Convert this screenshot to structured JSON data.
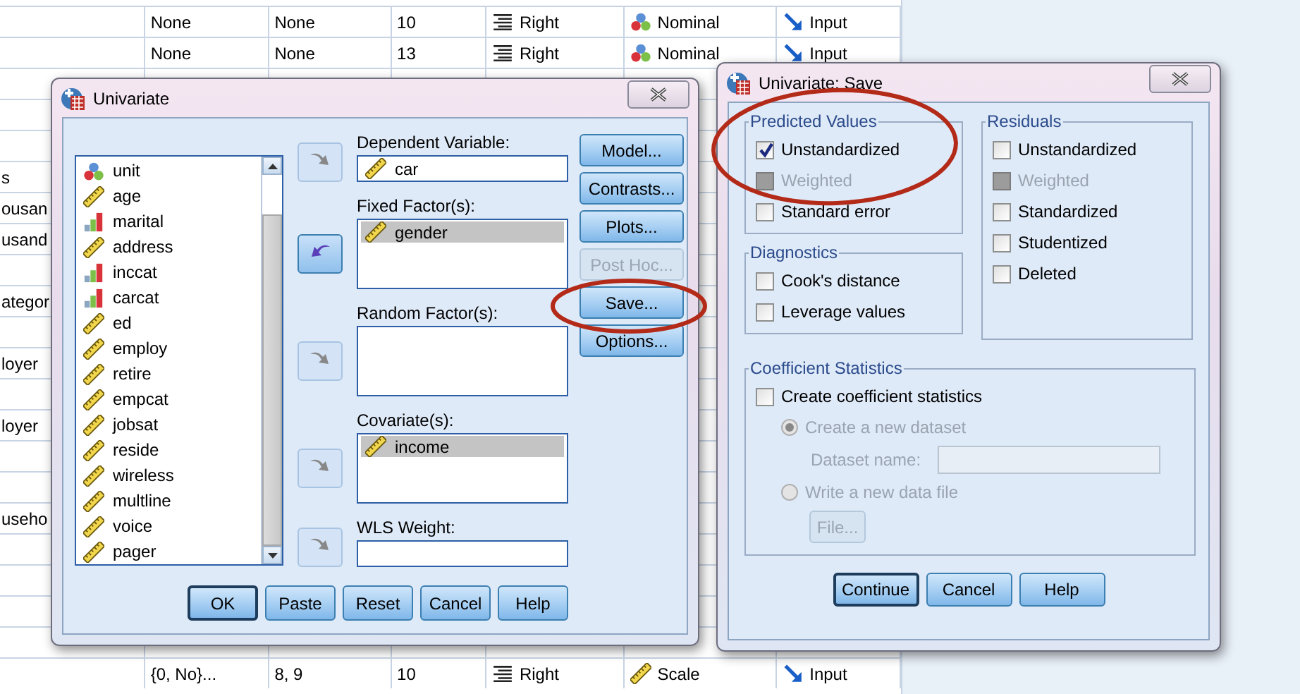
{
  "grid": {
    "rows": [
      {
        "kind": "nominal",
        "cells": [
          "None",
          "None",
          "10",
          "Right",
          "Nominal",
          "Input"
        ]
      },
      {
        "kind": "nominal",
        "cells": [
          "None",
          "None",
          "13",
          "Right",
          "Nominal",
          "Input"
        ]
      },
      {},
      {},
      {},
      {
        "label": "s"
      },
      {
        "label": "ousan"
      },
      {
        "label": "usand"
      },
      {},
      {
        "label": "ategor"
      },
      {},
      {
        "label": "loyer"
      },
      {},
      {
        "label": "loyer"
      },
      {},
      {},
      {
        "label": "useho"
      },
      {},
      {},
      {},
      {},
      {
        "kind": "scale",
        "cells": [
          "{0, No}...",
          "8, 9",
          "10",
          "Right",
          "Scale",
          "Input"
        ]
      }
    ]
  },
  "univariate": {
    "title": "Univariate",
    "variables": [
      {
        "name": "unit",
        "kind": "nominal"
      },
      {
        "name": "age",
        "kind": "scale"
      },
      {
        "name": "marital",
        "kind": "ordinal"
      },
      {
        "name": "address",
        "kind": "scale"
      },
      {
        "name": "inccat",
        "kind": "ordinal"
      },
      {
        "name": "carcat",
        "kind": "ordinal"
      },
      {
        "name": "ed",
        "kind": "scale"
      },
      {
        "name": "employ",
        "kind": "scale"
      },
      {
        "name": "retire",
        "kind": "scale"
      },
      {
        "name": "empcat",
        "kind": "scale"
      },
      {
        "name": "jobsat",
        "kind": "scale"
      },
      {
        "name": "reside",
        "kind": "scale"
      },
      {
        "name": "wireless",
        "kind": "scale"
      },
      {
        "name": "multline",
        "kind": "scale"
      },
      {
        "name": "voice",
        "kind": "scale"
      },
      {
        "name": "pager",
        "kind": "scale"
      }
    ],
    "targets": [
      {
        "label": "Dependent Variable:",
        "kind": "single",
        "arrow_enabled": false,
        "items": [
          {
            "name": "car",
            "selected": false
          }
        ]
      },
      {
        "label": "Fixed Factor(s):",
        "kind": "list",
        "arrow_enabled": true,
        "items": [
          {
            "name": "gender",
            "selected": true
          }
        ]
      },
      {
        "label": "Random Factor(s):",
        "kind": "list",
        "arrow_enabled": false
      },
      {
        "label": "Covariate(s):",
        "kind": "list",
        "arrow_enabled": false,
        "items": [
          {
            "name": "income",
            "selected": true
          }
        ]
      },
      {
        "label": "WLS Weight:",
        "kind": "single",
        "arrow_enabled": false
      }
    ],
    "side_buttons": [
      {
        "label": "Model...",
        "disabled": false
      },
      {
        "label": "Contrasts...",
        "disabled": false
      },
      {
        "label": "Plots...",
        "disabled": false
      },
      {
        "label": "Post Hoc...",
        "disabled": true
      },
      {
        "label": "Save...",
        "disabled": false
      },
      {
        "label": "Options...",
        "disabled": false
      }
    ],
    "buttons": [
      {
        "label": "OK",
        "default": true
      },
      {
        "label": "Paste",
        "default": false
      },
      {
        "label": "Reset",
        "default": false
      },
      {
        "label": "Cancel",
        "default": false
      },
      {
        "label": "Help",
        "default": false
      }
    ]
  },
  "save": {
    "title": "Univariate: Save",
    "predicted": {
      "title": "Predicted Values",
      "options": [
        {
          "label": "Unstandardized",
          "checked": true,
          "disabled": false
        },
        {
          "label": "Weighted",
          "checked": false,
          "disabled": true
        },
        {
          "label": "Standard error",
          "checked": false,
          "disabled": false
        }
      ]
    },
    "diagnostics": {
      "title": "Diagnostics",
      "options": [
        {
          "label": "Cook's distance",
          "checked": false,
          "disabled": false
        },
        {
          "label": "Leverage values",
          "checked": false,
          "disabled": false
        }
      ]
    },
    "residuals": {
      "title": "Residuals",
      "options": [
        {
          "label": "Unstandardized",
          "checked": false,
          "disabled": false
        },
        {
          "label": "Weighted",
          "checked": false,
          "disabled": true
        },
        {
          "label": "Standardized",
          "checked": false,
          "disabled": false
        },
        {
          "label": "Studentized",
          "checked": false,
          "disabled": false
        },
        {
          "label": "Deleted",
          "checked": false,
          "disabled": false
        }
      ]
    },
    "coefficient": {
      "title": "Coefficient Statistics",
      "create": {
        "label": "Create coefficient statistics",
        "checked": false,
        "disabled": false
      },
      "new_dataset": {
        "label": "Create a new dataset",
        "selected": true,
        "disabled": true
      },
      "dataset_name": {
        "label": "Dataset name:",
        "disabled": true
      },
      "new_file": {
        "label": "Write a new data file",
        "selected": false,
        "disabled": true
      },
      "file_button": {
        "label": "File...",
        "disabled": true
      }
    },
    "buttons": [
      {
        "label": "Continue",
        "default": true
      },
      {
        "label": "Cancel",
        "default": false
      },
      {
        "label": "Help",
        "default": false
      }
    ]
  }
}
